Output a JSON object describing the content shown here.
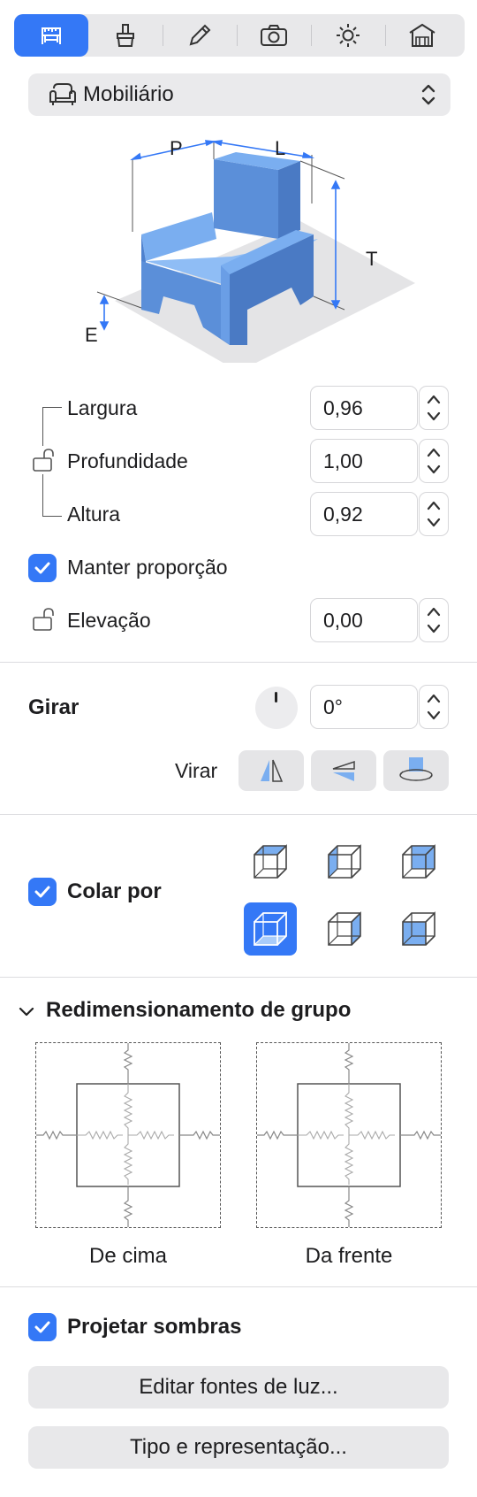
{
  "toolbar": {
    "tabs": [
      {
        "icon": "ruler-chair-icon",
        "active": true
      },
      {
        "icon": "brush-icon",
        "active": false
      },
      {
        "icon": "pencil-icon",
        "active": false
      },
      {
        "icon": "camera-icon",
        "active": false
      },
      {
        "icon": "sun-icon",
        "active": false
      },
      {
        "icon": "house-icon",
        "active": false
      }
    ]
  },
  "category": {
    "label": "Mobiliário",
    "icon": "armchair-icon"
  },
  "diagram": {
    "p": "P",
    "l": "L",
    "t": "T",
    "e": "E",
    "accent": "#3478f6",
    "furniture_color": "#5b8fd9"
  },
  "dimensions": {
    "width": {
      "label": "Largura",
      "value": "0,96"
    },
    "depth": {
      "label": "Profundidade",
      "value": "1,00"
    },
    "height": {
      "label": "Altura",
      "value": "0,92"
    },
    "keep_proportion": {
      "label": "Manter proporção",
      "checked": true
    },
    "elevation": {
      "label": "Elevação",
      "value": "0,00"
    }
  },
  "rotate": {
    "label": "Girar",
    "value": "0°",
    "flip_label": "Virar"
  },
  "attach": {
    "label": "Colar por",
    "checked": true
  },
  "group_resize": {
    "title": "Redimensionamento de grupo",
    "top_label": "De cima",
    "front_label": "Da frente"
  },
  "shadows": {
    "label": "Projetar sombras",
    "checked": true
  },
  "buttons": {
    "edit_lights": "Editar fontes de luz...",
    "type_representation": "Tipo e representação..."
  },
  "colors": {
    "accent": "#3478f6",
    "panel": "#e8e8ea"
  }
}
